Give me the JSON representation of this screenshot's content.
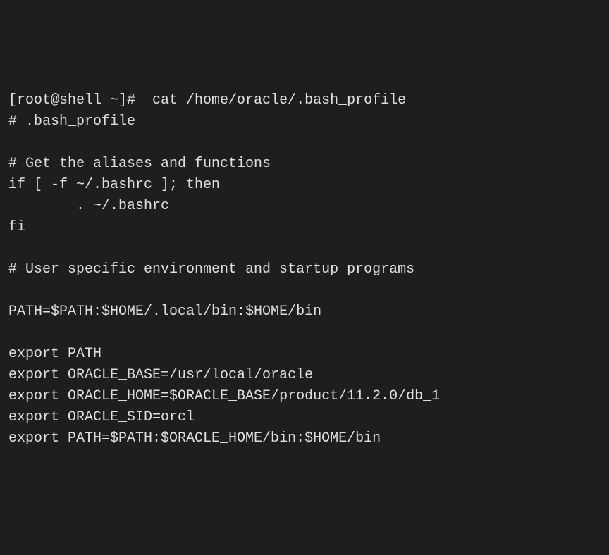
{
  "terminal": {
    "lines": [
      "[root@shell ~]#  cat /home/oracle/.bash_profile",
      "# .bash_profile",
      "",
      "# Get the aliases and functions",
      "if [ -f ~/.bashrc ]; then",
      "        . ~/.bashrc",
      "fi",
      "",
      "# User specific environment and startup programs",
      "",
      "PATH=$PATH:$HOME/.local/bin:$HOME/bin",
      "",
      "export PATH",
      "export ORACLE_BASE=/usr/local/oracle",
      "export ORACLE_HOME=$ORACLE_BASE/product/11.2.0/db_1",
      "export ORACLE_SID=orcl",
      "export PATH=$PATH:$ORACLE_HOME/bin:$HOME/bin"
    ]
  }
}
